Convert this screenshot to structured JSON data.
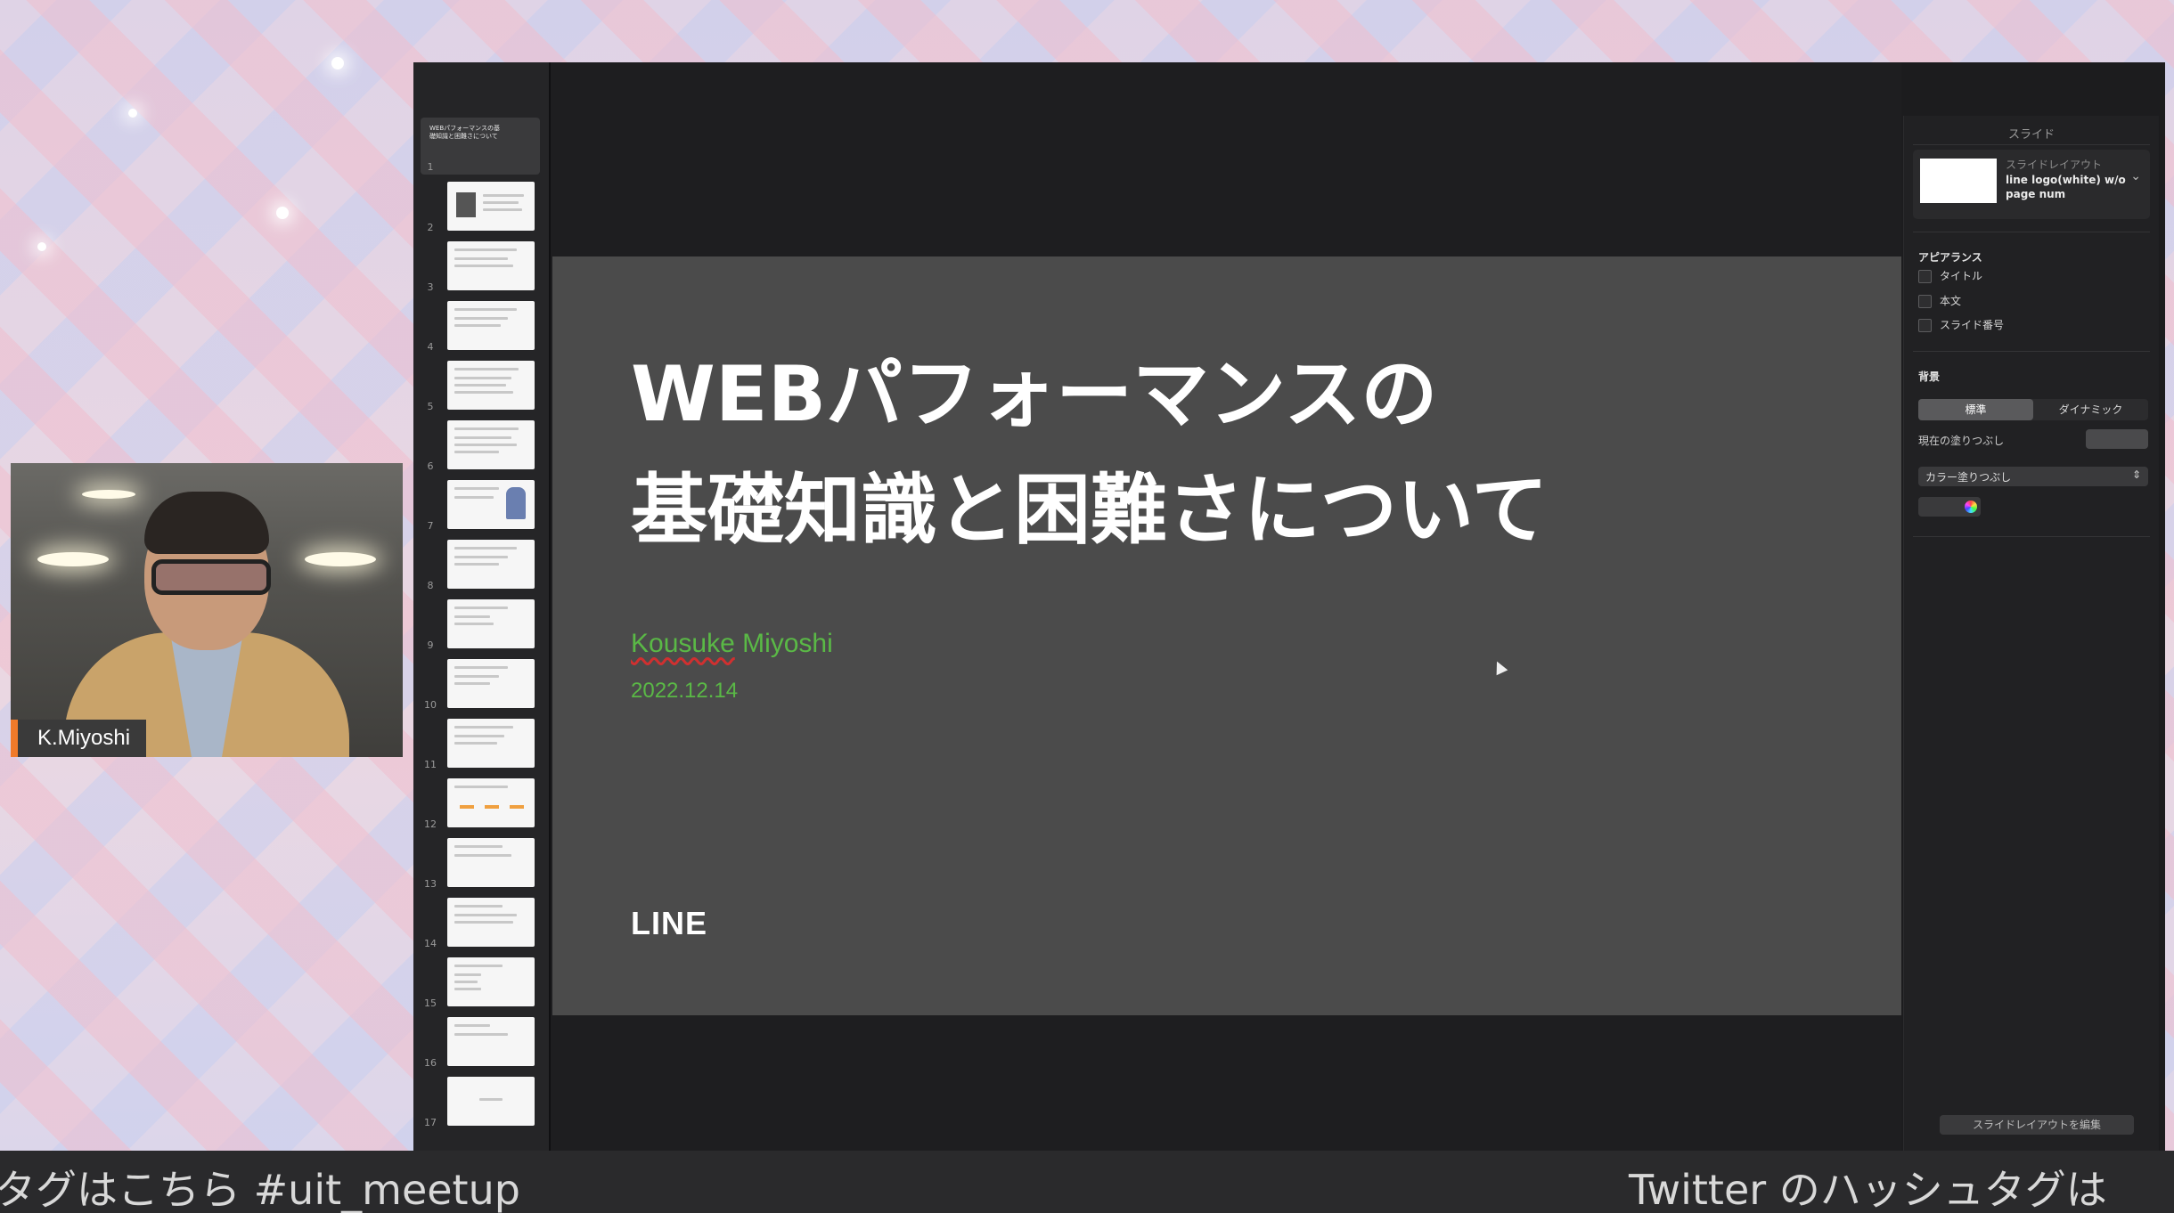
{
  "nav": {
    "first_slide_title": "WEBパフォーマンスの基礎知識と困難さについて",
    "slide_numbers": [
      "1",
      "2",
      "3",
      "4",
      "5",
      "6",
      "7",
      "8",
      "9",
      "10",
      "11",
      "12",
      "13",
      "14",
      "15",
      "16",
      "17"
    ]
  },
  "slide": {
    "title_line1": "WEBパフォーマンスの",
    "title_line2": "基礎知識と困難さについて",
    "author_first": "Kousuke",
    "author_last": " Miyoshi",
    "date": "2022.12.14",
    "logo": "LINE",
    "colors": {
      "background": "#4b4b4b",
      "accent": "#5ab946"
    }
  },
  "inspector": {
    "header": "スライド",
    "layout_label": "スライドレイアウト",
    "layout_value": "line logo(white) w/o page num",
    "appearance_label": "アピアランス",
    "appearance_items": [
      "タイトル",
      "本文",
      "スライド番号"
    ],
    "background_label": "背景",
    "segment": [
      "標準",
      "ダイナミック"
    ],
    "current_fill_label": "現在の塗りつぶし",
    "fill_type": "カラー塗りつぶし",
    "edit_layout_button": "スライドレイアウトを編集"
  },
  "webcam": {
    "name": "K.Miyoshi"
  },
  "ticker": {
    "left_text": "タグはこちら #uit_meetup",
    "right_text": "Twitter のハッシュタグは"
  }
}
